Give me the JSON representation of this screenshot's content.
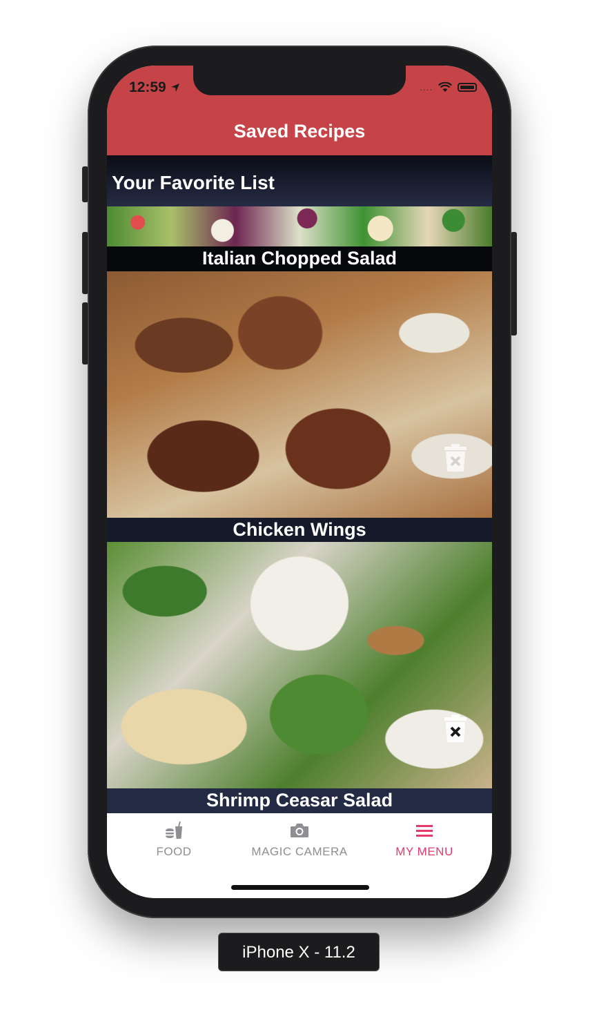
{
  "status_bar": {
    "time": "12:59",
    "signal": "....",
    "location_icon": "location-arrow-icon",
    "wifi_icon": "wifi-icon",
    "battery_icon": "battery-icon"
  },
  "header": {
    "title": "Saved Recipes",
    "color": "#c64448"
  },
  "favorites": {
    "title": "Your Favorite List",
    "recipes": [
      {
        "name": "Italian Chopped Salad"
      },
      {
        "name": "Chicken Wings",
        "delete_icon": "trash-icon"
      },
      {
        "name": "Shrimp Ceasar Salad",
        "delete_icon": "trash-icon"
      }
    ]
  },
  "tabbar": {
    "tabs": [
      {
        "label": "FOOD",
        "icon": "food-icon",
        "active": false
      },
      {
        "label": "MAGIC CAMERA",
        "icon": "camera-icon",
        "active": false
      },
      {
        "label": "MY MENU",
        "icon": "menu-icon",
        "active": true
      }
    ],
    "active_color": "#e8386b",
    "inactive_color": "#8e8e93"
  },
  "device_caption": "iPhone X - 11.2"
}
